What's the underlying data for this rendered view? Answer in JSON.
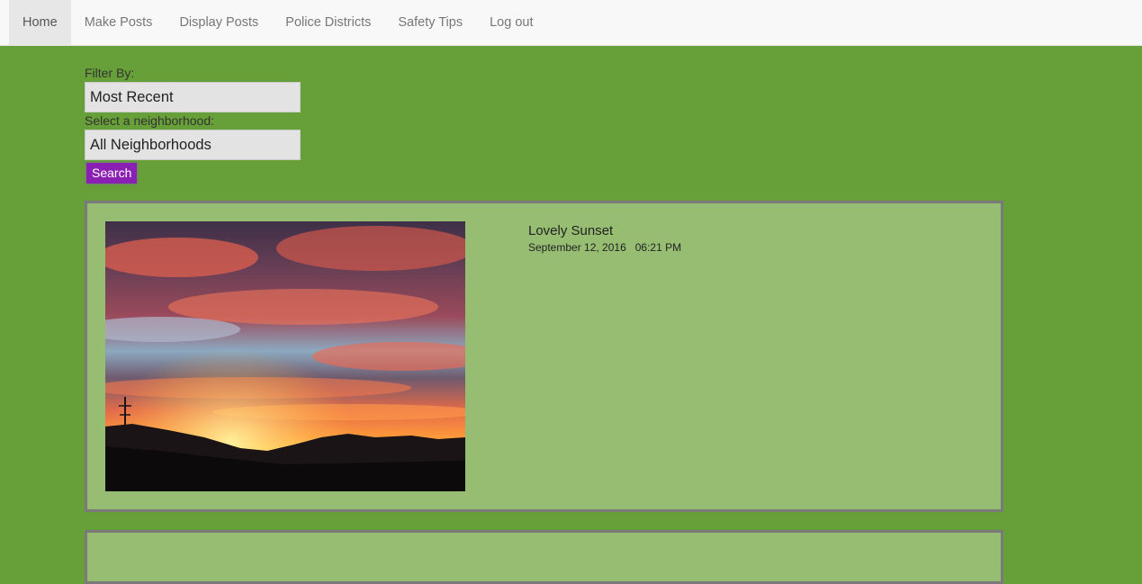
{
  "nav": {
    "items": [
      {
        "label": "Home",
        "active": true
      },
      {
        "label": "Make Posts"
      },
      {
        "label": "Display Posts"
      },
      {
        "label": "Police Districts"
      },
      {
        "label": "Safety Tips"
      },
      {
        "label": "Log out"
      }
    ]
  },
  "filters": {
    "filter_label": "Filter By:",
    "filter_value": "Most Recent",
    "neighborhood_label": "Select a neighborhood:",
    "neighborhood_value": "All Neighborhoods",
    "search_label": "Search"
  },
  "posts": [
    {
      "title": "Lovely Sunset",
      "date": "September 12, 2016",
      "time": "06:21 PM"
    }
  ],
  "colors": {
    "page_background": "#67a038",
    "card_background": "#97bd72",
    "search_button": "#8a1fb3"
  }
}
